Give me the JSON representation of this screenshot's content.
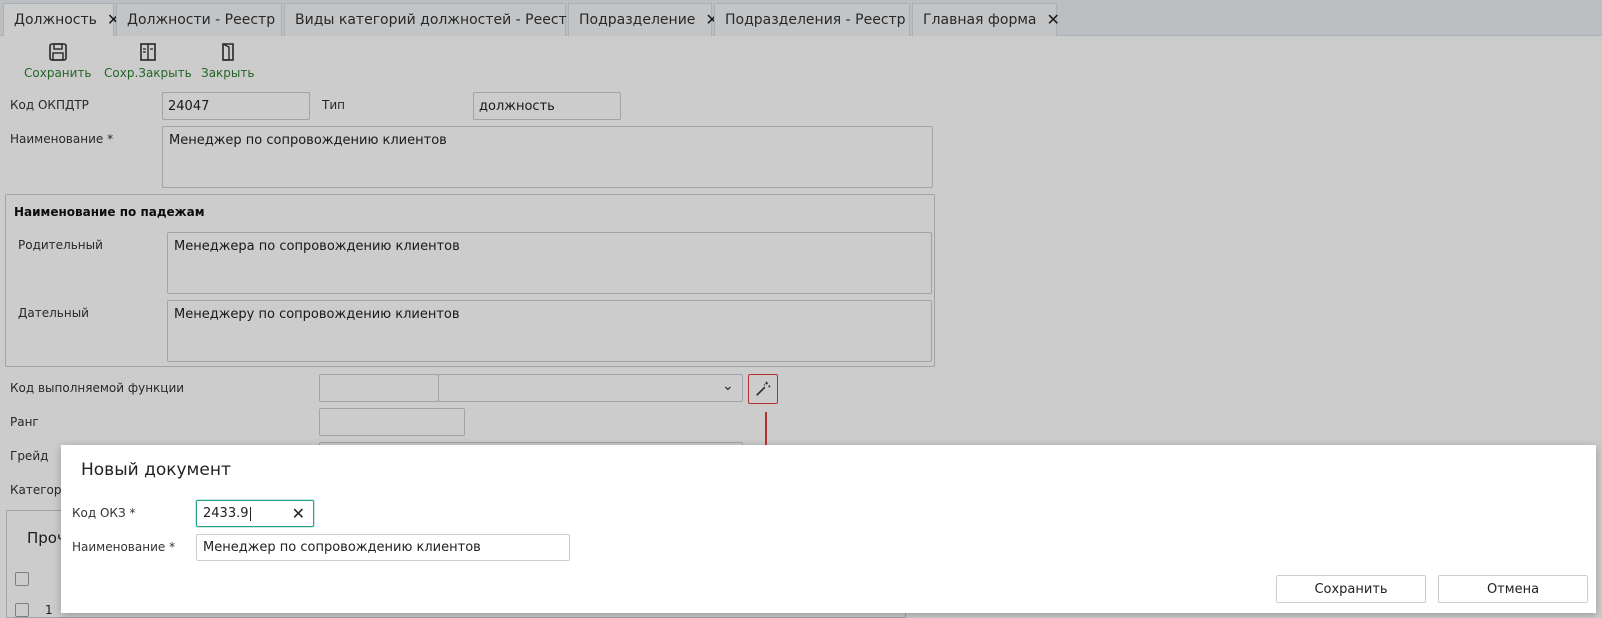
{
  "tabs": [
    {
      "label": "Должность",
      "active": true
    },
    {
      "label": "Должности - Реестр",
      "active": false
    },
    {
      "label": "Виды категорий должностей - Реестр",
      "active": false
    },
    {
      "label": "Подразделение",
      "active": false
    },
    {
      "label": "Подразделения - Реестр",
      "active": false
    },
    {
      "label": "Главная форма",
      "active": false
    }
  ],
  "tab_close_glyph": "✕",
  "toolbar": {
    "save_label": "Сохранить",
    "save_close_label": "Сохр.Закрыть",
    "close_label": "Закрыть",
    "icons": [
      "save-icon",
      "save-close-icon",
      "close-door-icon"
    ],
    "accent_color": "#2e7d32"
  },
  "form": {
    "okpdtr_label": "Код ОКПДТР",
    "okpdtr_value": "24047",
    "type_label": "Тип",
    "type_value": "должность",
    "name_label": "Наименование *",
    "name_value": "Менеджер по сопровождению клиентов",
    "cases_group": {
      "title": "Наименование по падежам",
      "genitive_label": "Родительный",
      "genitive_value": "Менеджера по сопровождению клиентов",
      "dative_label": "Дательный",
      "dative_value": "Менеджеру по сопровождению клиентов"
    },
    "function_code_label": "Код выполняемой функции",
    "function_code_value": "",
    "rank_label": "Ранг",
    "rank_value": "",
    "grade_label": "Грейд",
    "category_label": "Категори",
    "wand_icon": "magic-wand-icon",
    "highlight_color": "#e03c3c"
  },
  "table": {
    "title_fragment": "Проч",
    "row_number": "1"
  },
  "dialog": {
    "title": "Новый документ",
    "okz_label": "Код ОКЗ *",
    "okz_value": "2433.9",
    "name_label": "Наименование *",
    "name_value": "Менеджер по сопровождению клиентов",
    "clear_glyph": "✕",
    "save_button": "Сохранить",
    "cancel_button": "Отмена",
    "focus_color": "#27a38a"
  }
}
